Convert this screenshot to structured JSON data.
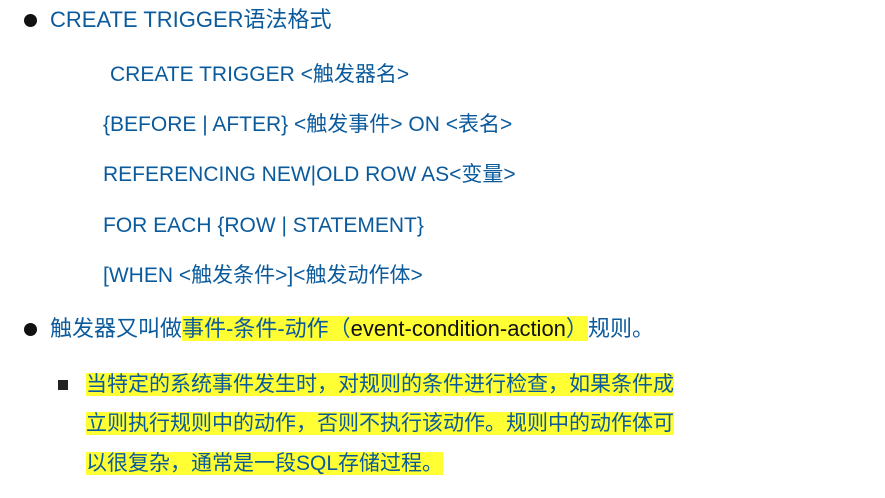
{
  "bullet1": {
    "title": "CREATE TRIGGER语法格式",
    "syntax": [
      "CREATE TRIGGER <触发器名>",
      "{BEFORE | AFTER} <触发事件> ON <表名>",
      "REFERENCING NEW|OLD ROW AS<变量>",
      "FOR EACH  {ROW | STATEMENT}",
      "[WHEN <触发条件>]<触发动作体>"
    ]
  },
  "bullet2": {
    "prefix": "触发器又叫做",
    "highlight_a": "事件-条件-动作（",
    "highlight_b": "event-condition-action",
    "highlight_c": "）",
    "suffix": "规则。"
  },
  "sub": {
    "lines": [
      "当特定的系统事件发生时，对规则的条件进行检查，如果条件成",
      "立则执行规则中的动作，否则不执行该动作。规则中的动作体可",
      "以很复杂，通常是一段SQL存储过程。"
    ]
  }
}
